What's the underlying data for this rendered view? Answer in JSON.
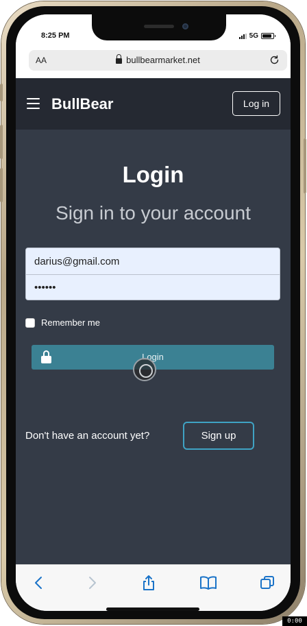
{
  "status_bar": {
    "time": "8:25 PM",
    "network": "5G",
    "battery_level": 0.85
  },
  "browser": {
    "text_size": "AA",
    "url": "bullbearmarket.net"
  },
  "header": {
    "brand": "BullBear",
    "login_label": "Log in"
  },
  "login_form": {
    "title": "Login",
    "subtitle": "Sign in to your account",
    "email_value": "darius@gmail.com",
    "password_value": "••••••",
    "remember_label": "Remember me",
    "remember_checked": false,
    "login_button_label": "Login"
  },
  "signup": {
    "prompt": "Don't have an account yet?",
    "button_label": "Sign up"
  },
  "toolbar": {
    "icons": [
      "back-icon",
      "forward-icon",
      "share-icon",
      "bookmarks-icon",
      "tabs-icon"
    ]
  },
  "recording_badge": "0:00",
  "colors": {
    "header_bg": "#252932",
    "main_bg": "#343b47",
    "login_button": "#3b8193",
    "signup_border": "#3fa3c4",
    "toolbar_accent": "#1a73c8"
  }
}
